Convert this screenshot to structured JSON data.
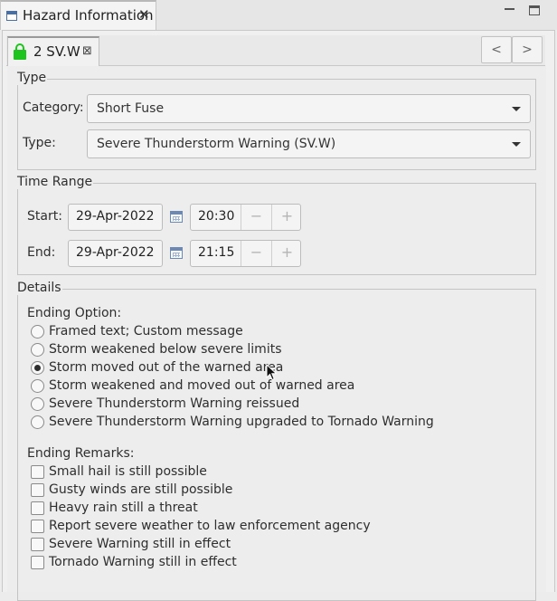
{
  "view": {
    "title": "Hazard Information",
    "close_glyph": "✕"
  },
  "editor_tab": {
    "label": "2 SV.W",
    "close_glyph": "⊠",
    "icon": "lock-icon",
    "lock_color": "#1ec41e"
  },
  "nav": {
    "prev": "<",
    "next": ">"
  },
  "type_group": {
    "legend": "Type",
    "category_label": "Category:",
    "category_value": "Short Fuse",
    "type_label": "Type:",
    "type_value": "Severe Thunderstorm Warning (SV.W)"
  },
  "time_group": {
    "legend": "Time Range",
    "start_label": "Start:",
    "start_date": "29-Apr-2022",
    "start_time": "20:30",
    "end_label": "End:",
    "end_date": "29-Apr-2022",
    "end_time": "21:15",
    "minus": "−",
    "plus": "+"
  },
  "details_group": {
    "legend": "Details",
    "ending_option_label": "Ending Option:",
    "ending_options": [
      {
        "label": "Framed text; Custom message",
        "selected": false
      },
      {
        "label": "Storm weakened below severe limits",
        "selected": false
      },
      {
        "label": "Storm moved out of the warned area",
        "selected": true
      },
      {
        "label": "Storm weakened and moved out of warned area",
        "selected": false
      },
      {
        "label": "Severe Thunderstorm Warning reissued",
        "selected": false
      },
      {
        "label": "Severe Thunderstorm Warning upgraded to Tornado Warning",
        "selected": false
      }
    ],
    "ending_remarks_label": "Ending Remarks:",
    "ending_remarks": [
      {
        "label": "Small hail is still possible",
        "checked": false
      },
      {
        "label": "Gusty winds are still possible",
        "checked": false
      },
      {
        "label": "Heavy rain still a threat",
        "checked": false
      },
      {
        "label": "Report severe weather to law enforcement agency",
        "checked": false
      },
      {
        "label": "Severe Warning still in effect",
        "checked": false
      },
      {
        "label": "Tornado Warning still in effect",
        "checked": false
      }
    ]
  }
}
